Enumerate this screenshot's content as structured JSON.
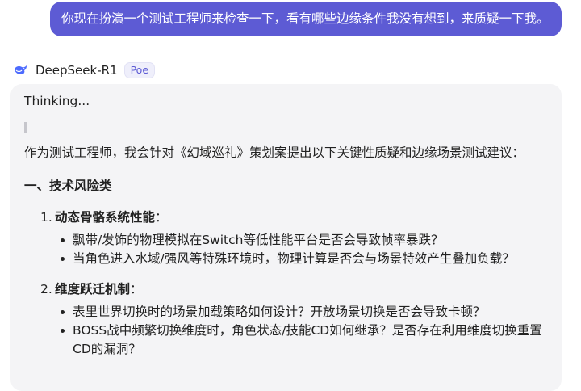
{
  "user_message": "你现在扮演一个测试工程师来检查一下，看有哪些边缘条件我没有想到，来质疑一下我。",
  "bot": {
    "name": "DeepSeek-R1",
    "tag": "Poe",
    "icon": "deepseek-whale-icon",
    "accent": "#5d5bd4"
  },
  "response": {
    "thinking_label": "Thinking...",
    "intro": "作为测试工程师，我会针对《幻域巡礼》策划案提出以下关键性质疑和边缘场景测试建议：",
    "section_heading": "一、技术风险类",
    "items": [
      {
        "number": "1.",
        "title": "动态骨骼系统性能",
        "colon": "：",
        "bullets": [
          "飘带/发饰的物理模拟在Switch等低性能平台是否会导致帧率暴跌？",
          "当角色进入水域/强风等特殊环境时，物理计算是否会与场景特效产生叠加负载？"
        ]
      },
      {
        "number": "2.",
        "title": "维度跃迁机制",
        "colon": "：",
        "bullets": [
          "表里世界切换时的场景加载策略如何设计？开放场景切换是否会导致卡顿？",
          "BOSS战中频繁切换维度时，角色状态/技能CD如何继承？是否存在利用维度切换重置CD的漏洞？"
        ]
      }
    ]
  }
}
